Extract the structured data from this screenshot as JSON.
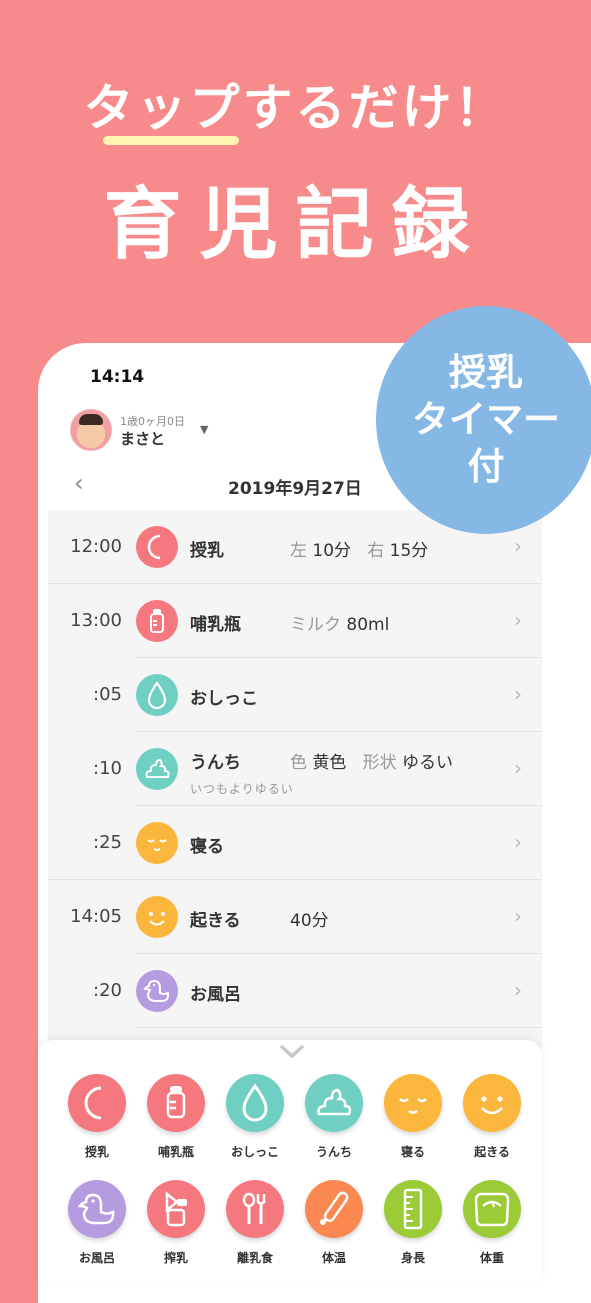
{
  "hero": {
    "line1": "タップするだけ！",
    "line2": "育児記録"
  },
  "badge": {
    "line1": "授乳",
    "line2": "タイマー",
    "line3": "付"
  },
  "status": {
    "time": "14:14"
  },
  "child": {
    "age": "1歳0ヶ月0日",
    "name": "まさと",
    "dropdown": "▼"
  },
  "nav": {
    "back": "‹",
    "date": "2019年9月27日"
  },
  "timeline": [
    {
      "time": "12:00",
      "icon": "nursing-icon",
      "title": "授乳",
      "k1": "左",
      "v1": "10分",
      "k2": "右",
      "v2": "15分"
    },
    {
      "time": "13:00",
      "icon": "bottle-icon",
      "title": "哺乳瓶",
      "k1": "ミルク",
      "v1": "80ml"
    },
    {
      "time": ":05",
      "icon": "pee-icon",
      "title": "おしっこ"
    },
    {
      "time": ":10",
      "icon": "poop-icon",
      "title": "うんち",
      "k1": "色",
      "v1": "黄色",
      "k2": "形状",
      "v2": "ゆるい",
      "note": "いつもよりゆるい"
    },
    {
      "time": ":25",
      "icon": "sleep-icon",
      "title": "寝る"
    },
    {
      "time": "14:05",
      "icon": "wake-icon",
      "title": "起きる",
      "v1": "40分"
    },
    {
      "time": ":20",
      "icon": "bath-icon",
      "title": "お風呂"
    }
  ],
  "quick_buttons": [
    {
      "label": "授乳",
      "icon": "nursing-icon",
      "color": "#f4787e"
    },
    {
      "label": "哺乳瓶",
      "icon": "bottle-icon",
      "color": "#f4787e"
    },
    {
      "label": "おしっこ",
      "icon": "pee-icon",
      "color": "#6fcfc3"
    },
    {
      "label": "うんち",
      "icon": "poop-icon",
      "color": "#6fcfc3"
    },
    {
      "label": "寝る",
      "icon": "sleep-icon",
      "color": "#fbb63c"
    },
    {
      "label": "起きる",
      "icon": "wake-icon",
      "color": "#fbb63c"
    },
    {
      "label": "お風呂",
      "icon": "bath-icon",
      "color": "#b59ce0"
    },
    {
      "label": "搾乳",
      "icon": "breast-pump-icon",
      "color": "#f4787e"
    },
    {
      "label": "離乳食",
      "icon": "baby-food-icon",
      "color": "#f4787e"
    },
    {
      "label": "体温",
      "icon": "thermometer-icon",
      "color": "#fa8850"
    },
    {
      "label": "身長",
      "icon": "ruler-icon",
      "color": "#9bcb36"
    },
    {
      "label": "体重",
      "icon": "scale-icon",
      "color": "#9bcb36"
    }
  ],
  "colors": {
    "background": "#f78a8a",
    "badge": "#86b8e6"
  }
}
